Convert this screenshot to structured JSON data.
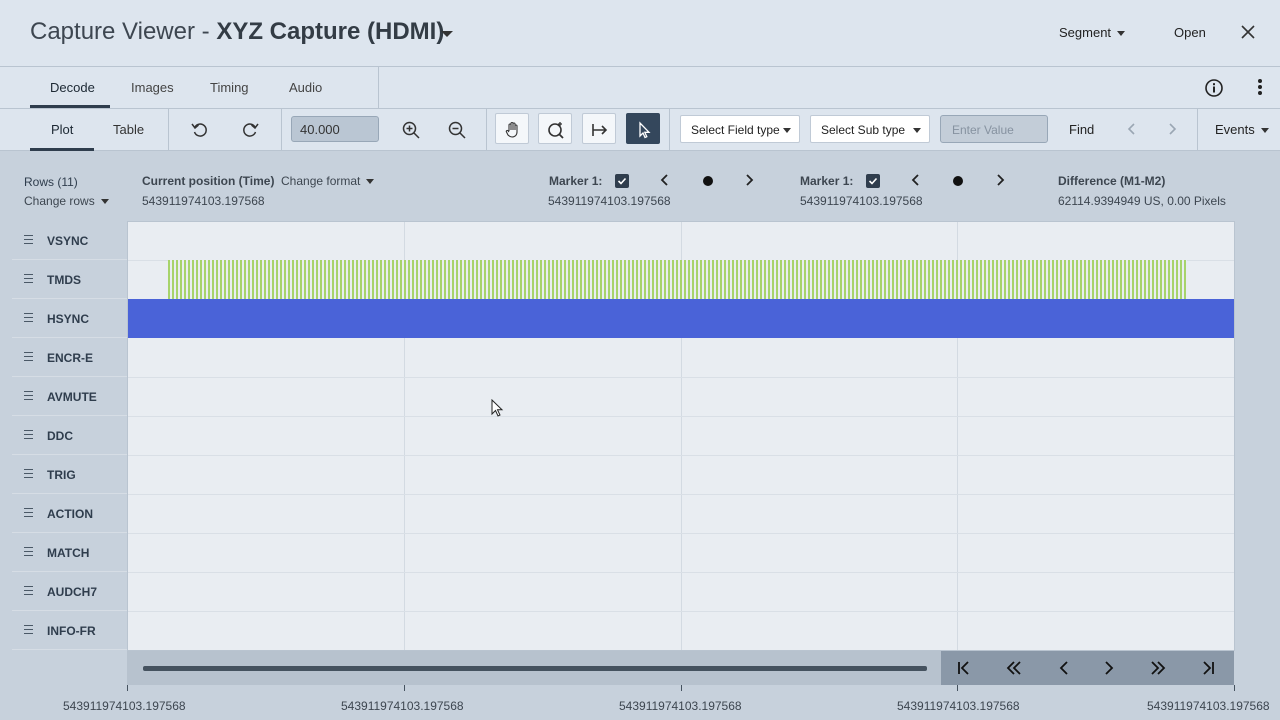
{
  "window": {
    "title_prefix": "Capture Viewer - ",
    "title_name": "XYZ Capture (HDMI)",
    "segment_label": "Segment",
    "open_label": "Open"
  },
  "tabs": [
    {
      "label": "Decode",
      "active": true
    },
    {
      "label": "Images",
      "active": false
    },
    {
      "label": "Timing",
      "active": false
    },
    {
      "label": "Audio",
      "active": false
    }
  ],
  "toolbar": {
    "view_tabs": [
      {
        "label": "Plot",
        "active": true
      },
      {
        "label": "Table",
        "active": false
      }
    ],
    "zoom_value": "40.000",
    "field_type_placeholder": "Select Field type",
    "sub_type_placeholder": "Select Sub type",
    "value_placeholder": "Enter Value",
    "find_label": "Find",
    "events_label": "Events"
  },
  "info": {
    "rows_label": "Rows (11)",
    "change_rows": "Change rows",
    "current_position_label": "Current position (Time)",
    "current_position_value": "543911974103.197568",
    "change_format": "Change format",
    "marker1": {
      "label": "Marker 1:",
      "value": "543911974103.197568",
      "checked": true
    },
    "marker2": {
      "label": "Marker 1:",
      "value": "543911974103.197568",
      "checked": true
    },
    "difference_label": "Difference (M1-M2)",
    "difference_value": "62114.9394949 US, 0.00 Pixels"
  },
  "rows": [
    {
      "name": "VSYNC"
    },
    {
      "name": "TMDS"
    },
    {
      "name": "HSYNC"
    },
    {
      "name": "ENCR-E"
    },
    {
      "name": "AVMUTE"
    },
    {
      "name": "DDC"
    },
    {
      "name": "TRIG"
    },
    {
      "name": "ACTION"
    },
    {
      "name": "MATCH"
    },
    {
      "name": "AUDCH7"
    },
    {
      "name": "INFO-FR"
    }
  ],
  "axis_labels": [
    "543911974103.197568",
    "543911974103.197568",
    "543911974103.197568",
    "543911974103.197568",
    "543911974103.197568"
  ],
  "colors": {
    "hsync": "#4a63d8",
    "tmds": "#a7d36b",
    "accent": "#2f3d4d"
  }
}
